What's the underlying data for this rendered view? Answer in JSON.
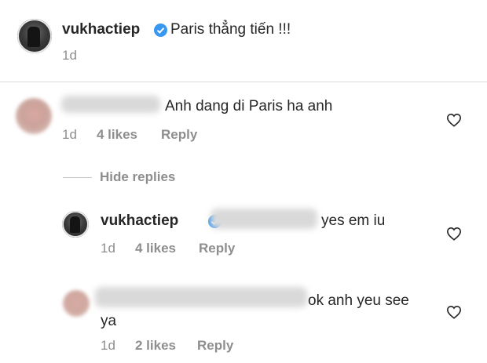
{
  "post": {
    "username": "vukhactiep",
    "caption": "Paris thẳng tiến !!!",
    "time": "1d"
  },
  "comments": [
    {
      "text": "Anh dang di Paris ha anh",
      "time": "1d",
      "likes": "4 likes",
      "reply_label": "Reply"
    }
  ],
  "hide_replies_label": "Hide replies",
  "replies": [
    {
      "username": "vukhactiep",
      "text": "yes em iu",
      "time": "1d",
      "likes": "4 likes",
      "reply_label": "Reply"
    },
    {
      "text_line1": "ok anh yeu see",
      "text_line2": "ya",
      "time": "1d",
      "likes": "2 likes",
      "reply_label": "Reply"
    }
  ],
  "colors": {
    "verified": "#3897f0",
    "meta": "#8e8e8e",
    "text": "#262626"
  },
  "icons": [
    "verified-badge-icon",
    "heart-icon"
  ]
}
